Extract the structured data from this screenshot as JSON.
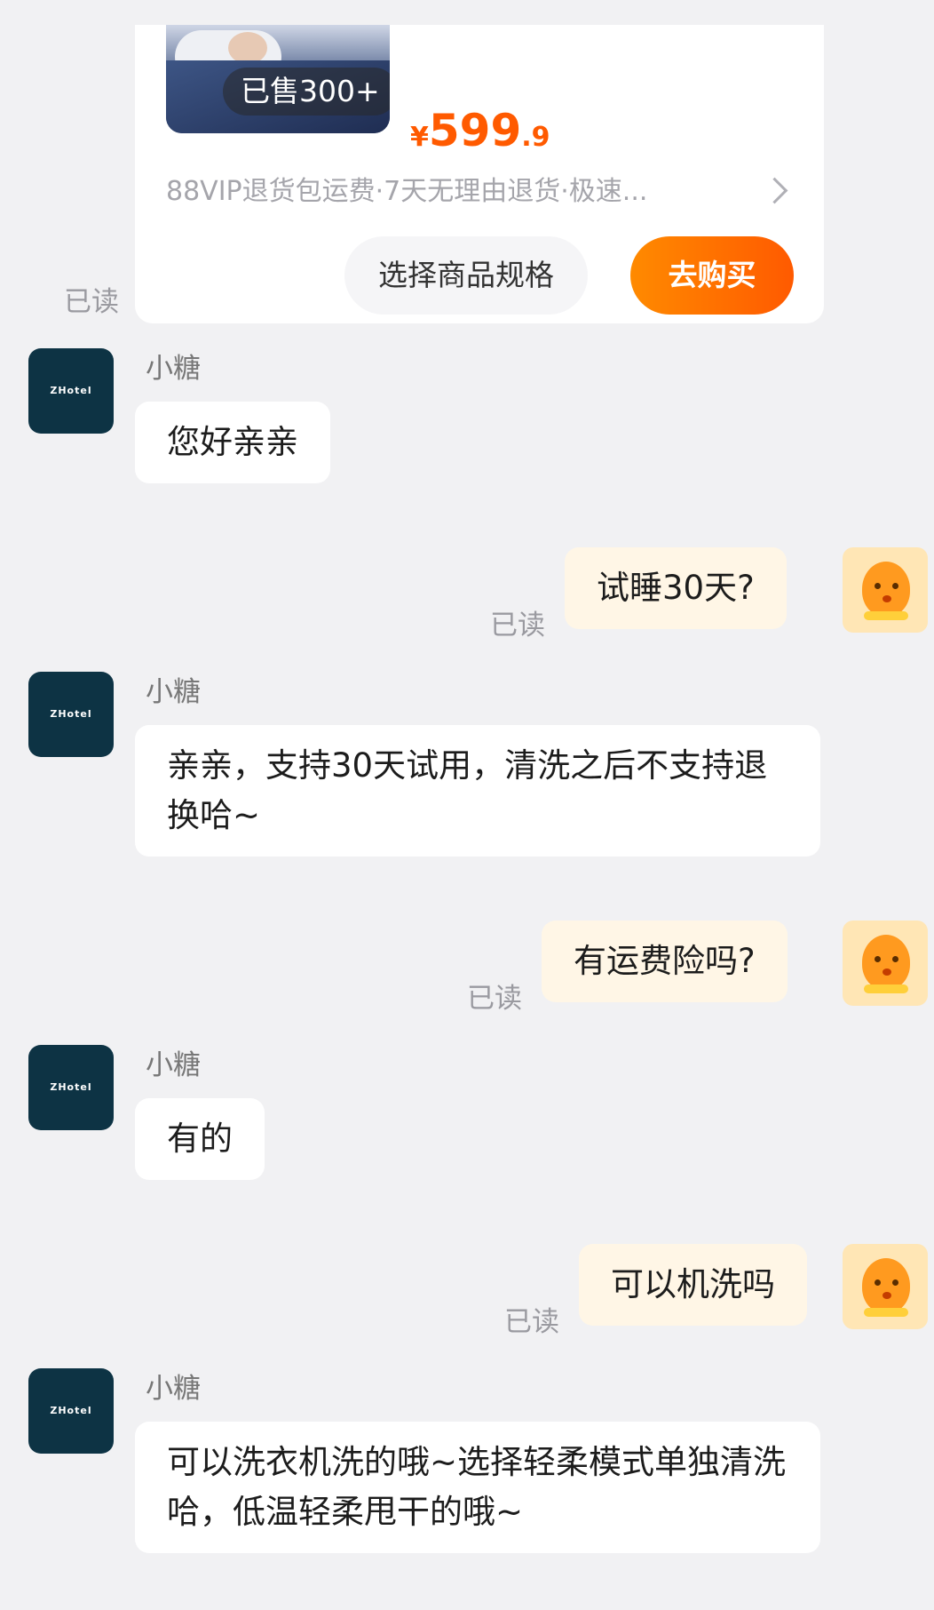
{
  "product": {
    "sold_badge": "已售300+",
    "price_currency": "¥",
    "price_integer": "599",
    "price_decimal": ".9",
    "services": "88VIP退货包运费·7天无理由退货·极速...",
    "spec_button": "选择商品规格",
    "buy_button": "去购买",
    "read_status": "已读"
  },
  "shop": {
    "avatar_text": "ZHotel",
    "name": "小糖"
  },
  "messages": [
    {
      "from": "shop",
      "text": "您好亲亲"
    },
    {
      "from": "me",
      "text": "试睡30天?",
      "status": "已读"
    },
    {
      "from": "shop",
      "text": "亲亲，支持30天试用，清洗之后不支持退换哈~"
    },
    {
      "from": "me",
      "text": "有运费险吗?",
      "status": "已读"
    },
    {
      "from": "shop",
      "text": "有的"
    },
    {
      "from": "me",
      "text": "可以机洗吗",
      "status": "已读"
    },
    {
      "from": "shop",
      "text": "可以洗衣机洗的哦~选择轻柔模式单独清洗哈，低温轻柔甩干的哦~"
    }
  ],
  "colors": {
    "accent": "#ff5a00",
    "my_bubble": "#fff6e6",
    "shop_avatar": "#0d3344",
    "background": "#f1f1f3"
  }
}
